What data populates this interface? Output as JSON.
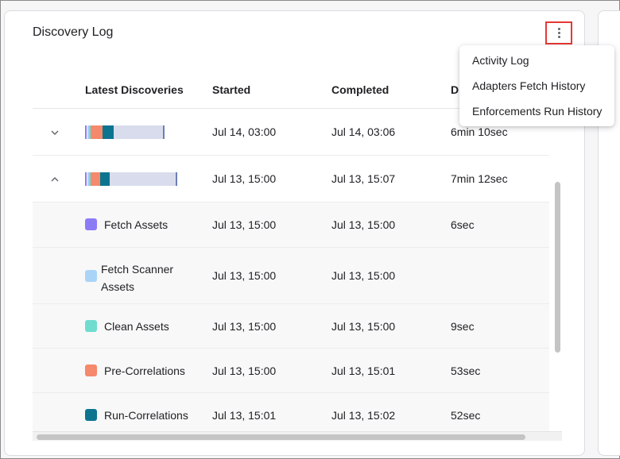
{
  "card": {
    "title": "Discovery Log"
  },
  "menu": {
    "items": [
      "Activity Log",
      "Adapters Fetch History",
      "Enforcements Run History"
    ]
  },
  "table": {
    "columns": [
      "Latest Discoveries",
      "Started",
      "Completed",
      "D"
    ],
    "rows": [
      {
        "expanded": false,
        "started": "Jul 14, 03:00",
        "completed": "Jul 14, 03:06",
        "duration": "6min 10sec"
      },
      {
        "expanded": true,
        "started": "Jul 13, 15:00",
        "completed": "Jul 13, 15:07",
        "duration": "7min 12sec"
      }
    ],
    "phases": [
      {
        "name": "Fetch Assets",
        "name_line1": "Fetch Assets",
        "name_line2": "",
        "started": "Jul 13, 15:00",
        "completed": "Jul 13, 15:00",
        "duration": "6sec",
        "color": "#8b7cf6"
      },
      {
        "name": "Fetch Scanner Assets",
        "name_line1": "Fetch Scanner",
        "name_line2": "Assets",
        "started": "Jul 13, 15:00",
        "completed": "Jul 13, 15:00",
        "duration": "",
        "color": "#a9d4f7"
      },
      {
        "name": "Clean Assets",
        "name_line1": "Clean Assets",
        "name_line2": "",
        "started": "Jul 13, 15:00",
        "completed": "Jul 13, 15:00",
        "duration": "9sec",
        "color": "#6fdccf"
      },
      {
        "name": "Pre-Correlations",
        "name_line1": "Pre-Correlations",
        "name_line2": "",
        "started": "Jul 13, 15:00",
        "completed": "Jul 13, 15:01",
        "duration": "53sec",
        "color": "#f5896b"
      },
      {
        "name": "Run-Correlations",
        "name_line1": "Run-Correlations",
        "name_line2": "",
        "started": "Jul 13, 15:01",
        "completed": "Jul 13, 15:02",
        "duration": "52sec",
        "color": "#0d7490"
      }
    ]
  },
  "colors": {
    "bar_track": "#d9dcec",
    "bar_end": "#6c7fb6",
    "highlight_border": "#e53935"
  }
}
